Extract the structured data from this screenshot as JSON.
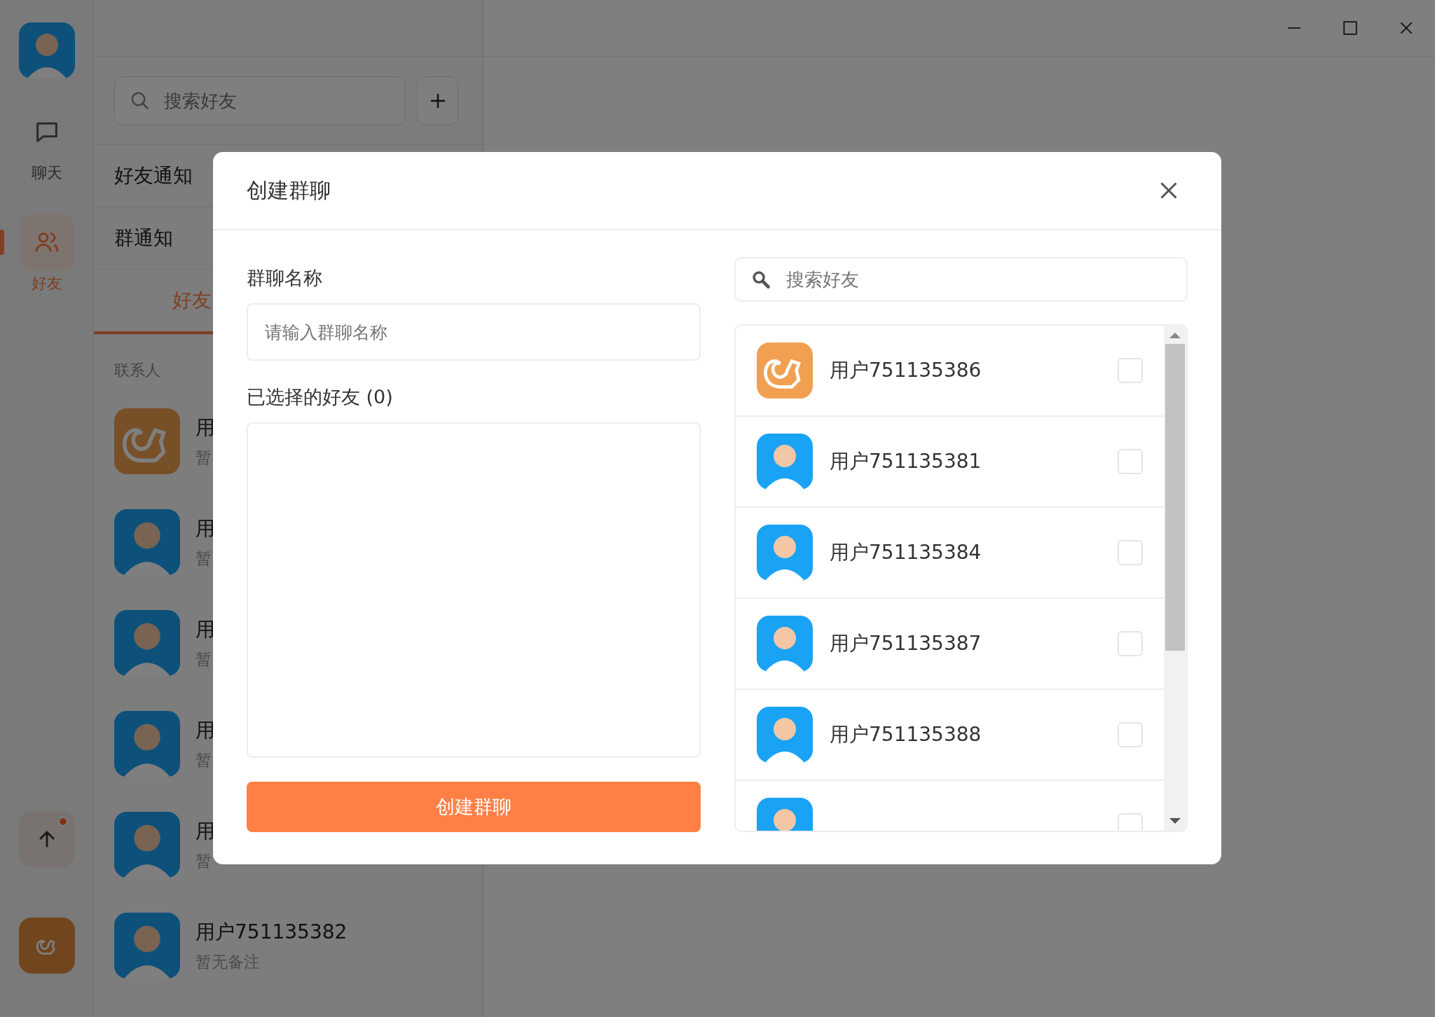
{
  "rail": {
    "profile": {
      "kind": "boy"
    },
    "items": [
      {
        "kind": "chat",
        "label": "聊天",
        "selected": false
      },
      {
        "kind": "friends",
        "label": "好友",
        "selected": true
      }
    ],
    "bottom": [
      {
        "kind": "upload",
        "badge": true
      },
      {
        "kind": "app"
      }
    ]
  },
  "contacts_panel": {
    "search": {
      "placeholder": "搜索好友"
    },
    "notices": [
      "好友通知",
      "群通知"
    ],
    "tabs": [
      {
        "label": "好友",
        "selected": true
      }
    ],
    "section": "联系人",
    "contacts": [
      {
        "kind": "squirrel",
        "name": "用",
        "note": "暂"
      },
      {
        "kind": "boy",
        "name": "用",
        "note": "暂"
      },
      {
        "kind": "boy",
        "name": "用",
        "note": "暂"
      },
      {
        "kind": "boy",
        "name": "用",
        "note": "暂"
      },
      {
        "kind": "boy",
        "name": "用",
        "note": "暂"
      },
      {
        "kind": "boy",
        "name": "用户751135382",
        "note": "暂无备注"
      }
    ]
  },
  "dialog": {
    "title": "创建群聊",
    "name_label": "群聊名称",
    "name_field": {
      "placeholder": "请输入群聊名称"
    },
    "selected_label": "已选择的好友 (0)",
    "submit": "创建群聊",
    "search": {
      "placeholder": "搜索好友"
    },
    "friends": [
      {
        "kind": "squirrel",
        "name": "用户751135386",
        "checked": false
      },
      {
        "kind": "boy",
        "name": "用户751135381",
        "checked": false
      },
      {
        "kind": "boy",
        "name": "用户751135384",
        "checked": false
      },
      {
        "kind": "boy",
        "name": "用户751135387",
        "checked": false
      },
      {
        "kind": "boy",
        "name": "用户751135388",
        "checked": false
      },
      {
        "kind": "boy",
        "checked": false
      }
    ]
  }
}
